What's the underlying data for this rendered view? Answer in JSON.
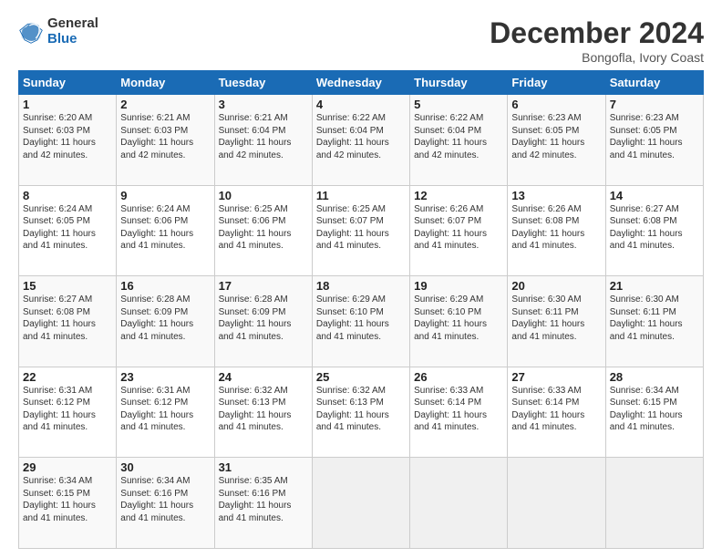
{
  "logo": {
    "general": "General",
    "blue": "Blue"
  },
  "title": "December 2024",
  "location": "Bongofla, Ivory Coast",
  "days_header": [
    "Sunday",
    "Monday",
    "Tuesday",
    "Wednesday",
    "Thursday",
    "Friday",
    "Saturday"
  ],
  "weeks": [
    [
      {
        "day": "1",
        "info": "Sunrise: 6:20 AM\nSunset: 6:03 PM\nDaylight: 11 hours\nand 42 minutes."
      },
      {
        "day": "2",
        "info": "Sunrise: 6:21 AM\nSunset: 6:03 PM\nDaylight: 11 hours\nand 42 minutes."
      },
      {
        "day": "3",
        "info": "Sunrise: 6:21 AM\nSunset: 6:04 PM\nDaylight: 11 hours\nand 42 minutes."
      },
      {
        "day": "4",
        "info": "Sunrise: 6:22 AM\nSunset: 6:04 PM\nDaylight: 11 hours\nand 42 minutes."
      },
      {
        "day": "5",
        "info": "Sunrise: 6:22 AM\nSunset: 6:04 PM\nDaylight: 11 hours\nand 42 minutes."
      },
      {
        "day": "6",
        "info": "Sunrise: 6:23 AM\nSunset: 6:05 PM\nDaylight: 11 hours\nand 42 minutes."
      },
      {
        "day": "7",
        "info": "Sunrise: 6:23 AM\nSunset: 6:05 PM\nDaylight: 11 hours\nand 41 minutes."
      }
    ],
    [
      {
        "day": "8",
        "info": "Sunrise: 6:24 AM\nSunset: 6:05 PM\nDaylight: 11 hours\nand 41 minutes."
      },
      {
        "day": "9",
        "info": "Sunrise: 6:24 AM\nSunset: 6:06 PM\nDaylight: 11 hours\nand 41 minutes."
      },
      {
        "day": "10",
        "info": "Sunrise: 6:25 AM\nSunset: 6:06 PM\nDaylight: 11 hours\nand 41 minutes."
      },
      {
        "day": "11",
        "info": "Sunrise: 6:25 AM\nSunset: 6:07 PM\nDaylight: 11 hours\nand 41 minutes."
      },
      {
        "day": "12",
        "info": "Sunrise: 6:26 AM\nSunset: 6:07 PM\nDaylight: 11 hours\nand 41 minutes."
      },
      {
        "day": "13",
        "info": "Sunrise: 6:26 AM\nSunset: 6:08 PM\nDaylight: 11 hours\nand 41 minutes."
      },
      {
        "day": "14",
        "info": "Sunrise: 6:27 AM\nSunset: 6:08 PM\nDaylight: 11 hours\nand 41 minutes."
      }
    ],
    [
      {
        "day": "15",
        "info": "Sunrise: 6:27 AM\nSunset: 6:08 PM\nDaylight: 11 hours\nand 41 minutes."
      },
      {
        "day": "16",
        "info": "Sunrise: 6:28 AM\nSunset: 6:09 PM\nDaylight: 11 hours\nand 41 minutes."
      },
      {
        "day": "17",
        "info": "Sunrise: 6:28 AM\nSunset: 6:09 PM\nDaylight: 11 hours\nand 41 minutes."
      },
      {
        "day": "18",
        "info": "Sunrise: 6:29 AM\nSunset: 6:10 PM\nDaylight: 11 hours\nand 41 minutes."
      },
      {
        "day": "19",
        "info": "Sunrise: 6:29 AM\nSunset: 6:10 PM\nDaylight: 11 hours\nand 41 minutes."
      },
      {
        "day": "20",
        "info": "Sunrise: 6:30 AM\nSunset: 6:11 PM\nDaylight: 11 hours\nand 41 minutes."
      },
      {
        "day": "21",
        "info": "Sunrise: 6:30 AM\nSunset: 6:11 PM\nDaylight: 11 hours\nand 41 minutes."
      }
    ],
    [
      {
        "day": "22",
        "info": "Sunrise: 6:31 AM\nSunset: 6:12 PM\nDaylight: 11 hours\nand 41 minutes."
      },
      {
        "day": "23",
        "info": "Sunrise: 6:31 AM\nSunset: 6:12 PM\nDaylight: 11 hours\nand 41 minutes."
      },
      {
        "day": "24",
        "info": "Sunrise: 6:32 AM\nSunset: 6:13 PM\nDaylight: 11 hours\nand 41 minutes."
      },
      {
        "day": "25",
        "info": "Sunrise: 6:32 AM\nSunset: 6:13 PM\nDaylight: 11 hours\nand 41 minutes."
      },
      {
        "day": "26",
        "info": "Sunrise: 6:33 AM\nSunset: 6:14 PM\nDaylight: 11 hours\nand 41 minutes."
      },
      {
        "day": "27",
        "info": "Sunrise: 6:33 AM\nSunset: 6:14 PM\nDaylight: 11 hours\nand 41 minutes."
      },
      {
        "day": "28",
        "info": "Sunrise: 6:34 AM\nSunset: 6:15 PM\nDaylight: 11 hours\nand 41 minutes."
      }
    ],
    [
      {
        "day": "29",
        "info": "Sunrise: 6:34 AM\nSunset: 6:15 PM\nDaylight: 11 hours\nand 41 minutes."
      },
      {
        "day": "30",
        "info": "Sunrise: 6:34 AM\nSunset: 6:16 PM\nDaylight: 11 hours\nand 41 minutes."
      },
      {
        "day": "31",
        "info": "Sunrise: 6:35 AM\nSunset: 6:16 PM\nDaylight: 11 hours\nand 41 minutes."
      },
      {
        "day": "",
        "info": ""
      },
      {
        "day": "",
        "info": ""
      },
      {
        "day": "",
        "info": ""
      },
      {
        "day": "",
        "info": ""
      }
    ]
  ]
}
